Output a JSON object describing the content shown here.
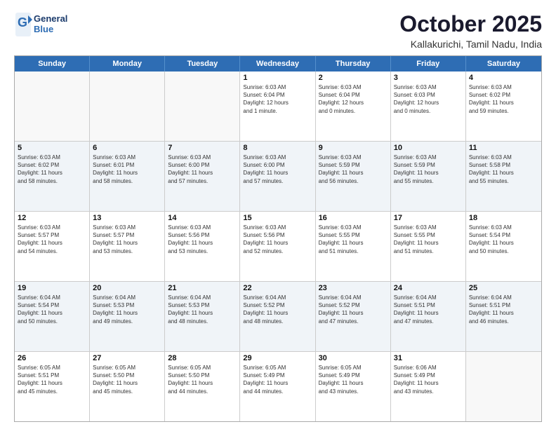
{
  "logo": {
    "general": "General",
    "blue": "Blue"
  },
  "title": "October 2025",
  "location": "Kallakurichi, Tamil Nadu, India",
  "days": [
    "Sunday",
    "Monday",
    "Tuesday",
    "Wednesday",
    "Thursday",
    "Friday",
    "Saturday"
  ],
  "rows": [
    [
      {
        "day": "",
        "empty": true
      },
      {
        "day": "",
        "empty": true
      },
      {
        "day": "",
        "empty": true
      },
      {
        "day": "1",
        "lines": [
          "Sunrise: 6:03 AM",
          "Sunset: 6:04 PM",
          "Daylight: 12 hours",
          "and 1 minute."
        ]
      },
      {
        "day": "2",
        "lines": [
          "Sunrise: 6:03 AM",
          "Sunset: 6:04 PM",
          "Daylight: 12 hours",
          "and 0 minutes."
        ]
      },
      {
        "day": "3",
        "lines": [
          "Sunrise: 6:03 AM",
          "Sunset: 6:03 PM",
          "Daylight: 12 hours",
          "and 0 minutes."
        ]
      },
      {
        "day": "4",
        "lines": [
          "Sunrise: 6:03 AM",
          "Sunset: 6:02 PM",
          "Daylight: 11 hours",
          "and 59 minutes."
        ]
      }
    ],
    [
      {
        "day": "5",
        "lines": [
          "Sunrise: 6:03 AM",
          "Sunset: 6:02 PM",
          "Daylight: 11 hours",
          "and 58 minutes."
        ]
      },
      {
        "day": "6",
        "lines": [
          "Sunrise: 6:03 AM",
          "Sunset: 6:01 PM",
          "Daylight: 11 hours",
          "and 58 minutes."
        ]
      },
      {
        "day": "7",
        "lines": [
          "Sunrise: 6:03 AM",
          "Sunset: 6:00 PM",
          "Daylight: 11 hours",
          "and 57 minutes."
        ]
      },
      {
        "day": "8",
        "lines": [
          "Sunrise: 6:03 AM",
          "Sunset: 6:00 PM",
          "Daylight: 11 hours",
          "and 57 minutes."
        ]
      },
      {
        "day": "9",
        "lines": [
          "Sunrise: 6:03 AM",
          "Sunset: 5:59 PM",
          "Daylight: 11 hours",
          "and 56 minutes."
        ]
      },
      {
        "day": "10",
        "lines": [
          "Sunrise: 6:03 AM",
          "Sunset: 5:59 PM",
          "Daylight: 11 hours",
          "and 55 minutes."
        ]
      },
      {
        "day": "11",
        "lines": [
          "Sunrise: 6:03 AM",
          "Sunset: 5:58 PM",
          "Daylight: 11 hours",
          "and 55 minutes."
        ]
      }
    ],
    [
      {
        "day": "12",
        "lines": [
          "Sunrise: 6:03 AM",
          "Sunset: 5:57 PM",
          "Daylight: 11 hours",
          "and 54 minutes."
        ]
      },
      {
        "day": "13",
        "lines": [
          "Sunrise: 6:03 AM",
          "Sunset: 5:57 PM",
          "Daylight: 11 hours",
          "and 53 minutes."
        ]
      },
      {
        "day": "14",
        "lines": [
          "Sunrise: 6:03 AM",
          "Sunset: 5:56 PM",
          "Daylight: 11 hours",
          "and 53 minutes."
        ]
      },
      {
        "day": "15",
        "lines": [
          "Sunrise: 6:03 AM",
          "Sunset: 5:56 PM",
          "Daylight: 11 hours",
          "and 52 minutes."
        ]
      },
      {
        "day": "16",
        "lines": [
          "Sunrise: 6:03 AM",
          "Sunset: 5:55 PM",
          "Daylight: 11 hours",
          "and 51 minutes."
        ]
      },
      {
        "day": "17",
        "lines": [
          "Sunrise: 6:03 AM",
          "Sunset: 5:55 PM",
          "Daylight: 11 hours",
          "and 51 minutes."
        ]
      },
      {
        "day": "18",
        "lines": [
          "Sunrise: 6:03 AM",
          "Sunset: 5:54 PM",
          "Daylight: 11 hours",
          "and 50 minutes."
        ]
      }
    ],
    [
      {
        "day": "19",
        "lines": [
          "Sunrise: 6:04 AM",
          "Sunset: 5:54 PM",
          "Daylight: 11 hours",
          "and 50 minutes."
        ]
      },
      {
        "day": "20",
        "lines": [
          "Sunrise: 6:04 AM",
          "Sunset: 5:53 PM",
          "Daylight: 11 hours",
          "and 49 minutes."
        ]
      },
      {
        "day": "21",
        "lines": [
          "Sunrise: 6:04 AM",
          "Sunset: 5:53 PM",
          "Daylight: 11 hours",
          "and 48 minutes."
        ]
      },
      {
        "day": "22",
        "lines": [
          "Sunrise: 6:04 AM",
          "Sunset: 5:52 PM",
          "Daylight: 11 hours",
          "and 48 minutes."
        ]
      },
      {
        "day": "23",
        "lines": [
          "Sunrise: 6:04 AM",
          "Sunset: 5:52 PM",
          "Daylight: 11 hours",
          "and 47 minutes."
        ]
      },
      {
        "day": "24",
        "lines": [
          "Sunrise: 6:04 AM",
          "Sunset: 5:51 PM",
          "Daylight: 11 hours",
          "and 47 minutes."
        ]
      },
      {
        "day": "25",
        "lines": [
          "Sunrise: 6:04 AM",
          "Sunset: 5:51 PM",
          "Daylight: 11 hours",
          "and 46 minutes."
        ]
      }
    ],
    [
      {
        "day": "26",
        "lines": [
          "Sunrise: 6:05 AM",
          "Sunset: 5:51 PM",
          "Daylight: 11 hours",
          "and 45 minutes."
        ]
      },
      {
        "day": "27",
        "lines": [
          "Sunrise: 6:05 AM",
          "Sunset: 5:50 PM",
          "Daylight: 11 hours",
          "and 45 minutes."
        ]
      },
      {
        "day": "28",
        "lines": [
          "Sunrise: 6:05 AM",
          "Sunset: 5:50 PM",
          "Daylight: 11 hours",
          "and 44 minutes."
        ]
      },
      {
        "day": "29",
        "lines": [
          "Sunrise: 6:05 AM",
          "Sunset: 5:49 PM",
          "Daylight: 11 hours",
          "and 44 minutes."
        ]
      },
      {
        "day": "30",
        "lines": [
          "Sunrise: 6:05 AM",
          "Sunset: 5:49 PM",
          "Daylight: 11 hours",
          "and 43 minutes."
        ]
      },
      {
        "day": "31",
        "lines": [
          "Sunrise: 6:06 AM",
          "Sunset: 5:49 PM",
          "Daylight: 11 hours",
          "and 43 minutes."
        ]
      },
      {
        "day": "",
        "empty": true
      }
    ]
  ]
}
